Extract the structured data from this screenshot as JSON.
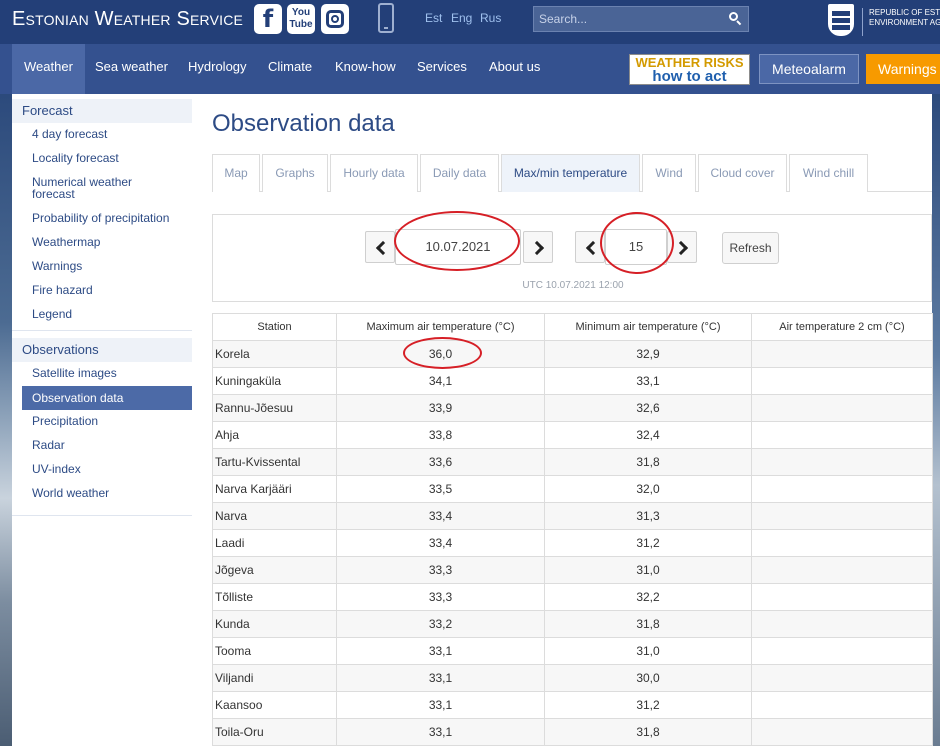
{
  "header": {
    "brand": "Estonian Weather Service",
    "social": {
      "facebook": "f",
      "youtube_line1": "You",
      "youtube_line2": "Tube"
    },
    "languages": [
      "Est",
      "Eng",
      "Rus"
    ],
    "search_placeholder": "Search...",
    "agency_line1": "Republic of Estonia",
    "agency_line2": "Environment Agency"
  },
  "nav": {
    "items": [
      "Weather",
      "Sea weather",
      "Hydrology",
      "Climate",
      "Know-how",
      "Services",
      "About us"
    ],
    "weather_risks_line1": "WEATHER RISKS",
    "weather_risks_line2": "how to act",
    "meteoalarm": "Meteoalarm",
    "warnings": "Warnings"
  },
  "sidebar": {
    "forecast_heading": "Forecast",
    "forecast_items": [
      "4 day forecast",
      "Locality forecast",
      "Numerical weather forecast",
      "Probability of precipitation",
      "Weathermap",
      "Warnings",
      "Fire hazard",
      "Legend"
    ],
    "observations_heading": "Observations",
    "observation_items": [
      "Satellite images",
      "Observation data",
      "Precipitation",
      "Radar",
      "UV-index",
      "World weather"
    ]
  },
  "main": {
    "title": "Observation data",
    "tabs": [
      "Map",
      "Graphs",
      "Hourly data",
      "Daily data",
      "Max/min temperature",
      "Wind",
      "Cloud cover",
      "Wind chill"
    ],
    "date_value": "10.07.2021",
    "hour_value": "15",
    "refresh_label": "Refresh",
    "utc_label": "UTC 10.07.2021 12:00"
  },
  "table": {
    "headers": [
      "Station",
      "Maximum air temperature (°C)",
      "Minimum air temperature (°C)",
      "Air temperature 2 cm (°C)"
    ],
    "rows": [
      [
        "Korela",
        "36,0",
        "32,9",
        ""
      ],
      [
        "Kuningaküla",
        "34,1",
        "33,1",
        ""
      ],
      [
        "Rannu-Jõesuu",
        "33,9",
        "32,6",
        ""
      ],
      [
        "Ahja",
        "33,8",
        "32,4",
        ""
      ],
      [
        "Tartu-Kvissental",
        "33,6",
        "31,8",
        ""
      ],
      [
        "Narva Karjääri",
        "33,5",
        "32,0",
        ""
      ],
      [
        "Narva",
        "33,4",
        "31,3",
        ""
      ],
      [
        "Laadi",
        "33,4",
        "31,2",
        ""
      ],
      [
        "Jõgeva",
        "33,3",
        "31,0",
        ""
      ],
      [
        "Tõlliste",
        "33,3",
        "32,2",
        ""
      ],
      [
        "Kunda",
        "33,2",
        "31,8",
        ""
      ],
      [
        "Tooma",
        "33,1",
        "31,0",
        ""
      ],
      [
        "Viljandi",
        "33,1",
        "30,0",
        ""
      ],
      [
        "Kaansoo",
        "33,1",
        "31,2",
        ""
      ],
      [
        "Toila-Oru",
        "33,1",
        "31,8",
        ""
      ]
    ]
  },
  "colors": {
    "header": "#233f78",
    "nav": "#34518f",
    "accent": "#f79a00",
    "annotation": "#d61f26"
  }
}
